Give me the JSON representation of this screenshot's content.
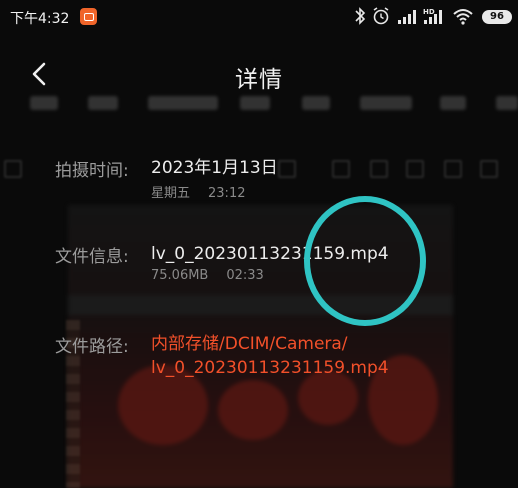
{
  "status_bar": {
    "time": "下午4:32",
    "battery": "96",
    "icons": [
      "bluetooth-icon",
      "alarm-icon",
      "signal-icon",
      "hd-signal-icon",
      "wifi-icon",
      "battery-icon"
    ]
  },
  "header": {
    "title": "详情",
    "back_icon": "chevron-left-icon"
  },
  "details": {
    "capture_time": {
      "label": "拍摄时间:",
      "value": "2023年1月13日",
      "weekday": "星期五",
      "clock": "23:12"
    },
    "file_info": {
      "label": "文件信息:",
      "value": "lv_0_20230113231159.mp4",
      "size": "75.06MB",
      "duration": "02:33"
    },
    "file_path": {
      "label": "文件路径:",
      "line1": "内部存储/DCIM/Camera/",
      "line2": "lv_0_20230113231159.mp4"
    }
  },
  "colors": {
    "background": "#0a0a0a",
    "label": "#9c9c9c",
    "value": "#ededed",
    "path_accent": "#f2502a",
    "annotation_circle": "#2fc4c4",
    "app_icon": "#f0652a"
  }
}
